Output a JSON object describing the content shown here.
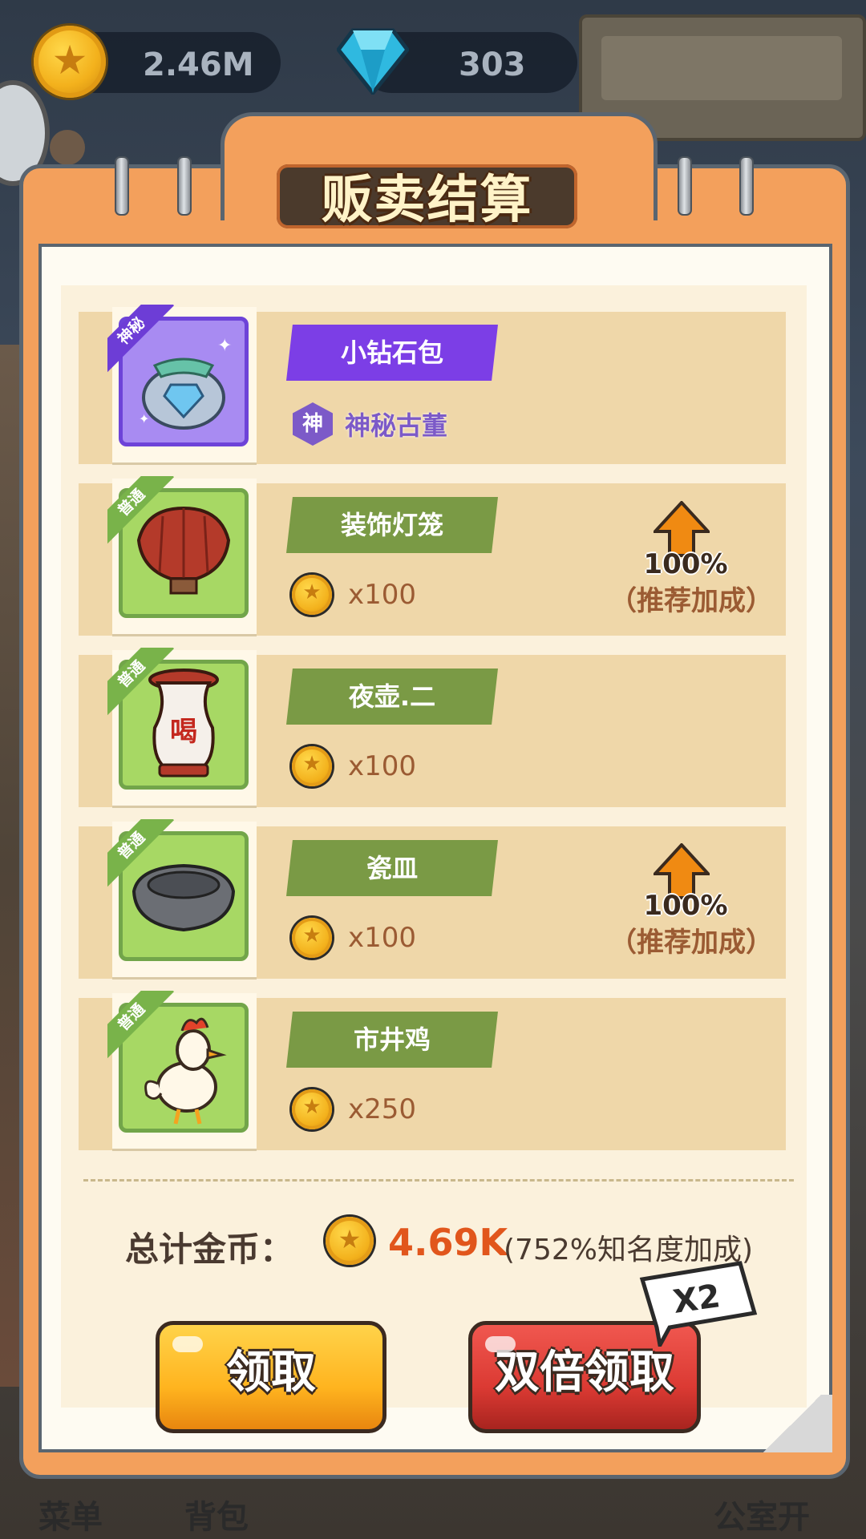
{
  "currency": {
    "gold": "2.46M",
    "gems": "303"
  },
  "background_bottom": {
    "left1": "菜单",
    "left2": "背包",
    "right": "公室开"
  },
  "panel": {
    "title": "贩卖结算"
  },
  "items": [
    {
      "name": "小钻石包",
      "rarity": "神秘",
      "rarity_kind": "mystic",
      "type_badge": "神",
      "type_label": "神秘古董",
      "price": ""
    },
    {
      "name": "装饰灯笼",
      "rarity": "普通",
      "rarity_kind": "common",
      "price": "x100",
      "bonus_percent": "100%",
      "bonus_label": "（推荐加成）"
    },
    {
      "name": "夜壶.二",
      "rarity": "普通",
      "rarity_kind": "common",
      "price": "x100"
    },
    {
      "name": "瓷皿",
      "rarity": "普通",
      "rarity_kind": "common",
      "price": "x100",
      "bonus_percent": "100%",
      "bonus_label": "（推荐加成）"
    },
    {
      "name": "市井鸡",
      "rarity": "普通",
      "rarity_kind": "common",
      "price": "x250"
    }
  ],
  "vase_glyph": "喝",
  "total": {
    "label": "总计金币：",
    "value": "4.69K",
    "bonus": "(752%知名度加成)"
  },
  "buttons": {
    "claim": "领取",
    "double_claim": "双倍领取",
    "x2_badge": "X2"
  },
  "colors": {
    "panel_orange": "#f3a05c",
    "common_green": "#a7d864",
    "mystic_purple": "#7c3ee6",
    "total_value": "#e1561c",
    "claim_yellow": "#ffb41f",
    "double_red": "#db3a33"
  }
}
